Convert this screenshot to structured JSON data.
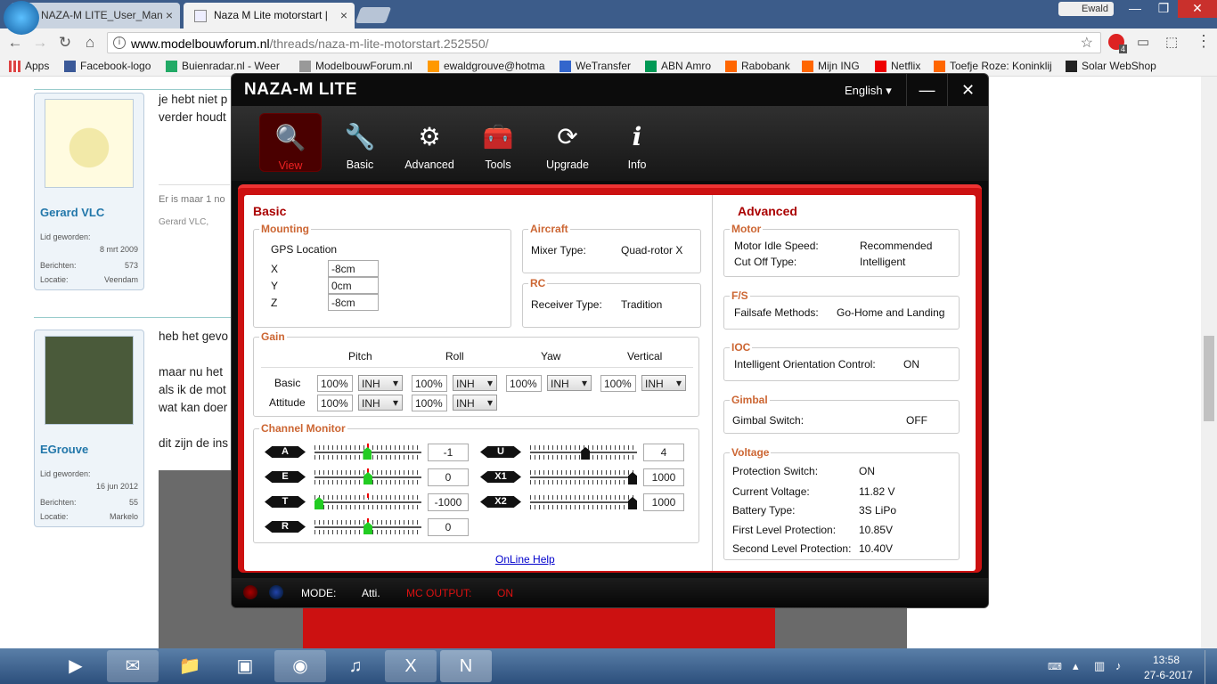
{
  "browser": {
    "tabs": [
      {
        "label": "NAZA-M LITE_User_Man"
      },
      {
        "label": "Naza M Lite motorstart |"
      }
    ],
    "profile": "Ewald",
    "url_domain": "www.modelbouwforum.nl",
    "url_path": "/threads/naza-m-lite-motorstart.252550/",
    "ext_badge": "4",
    "bookmarks": [
      {
        "label": "Apps",
        "color": "#d44"
      },
      {
        "label": "Facebook-logo",
        "color": "#3b5998"
      },
      {
        "label": "Buienradar.nl - Weer",
        "color": "#2a6"
      },
      {
        "label": "ModelbouwForum.nl",
        "color": "#999"
      },
      {
        "label": "ewaldgrouve@hotma",
        "color": "#f90"
      },
      {
        "label": "WeTransfer",
        "color": "#36c"
      },
      {
        "label": "ABN Amro",
        "color": "#095"
      },
      {
        "label": "Rabobank",
        "color": "#f60"
      },
      {
        "label": "Mijn ING",
        "color": "#f60"
      },
      {
        "label": "Netflix",
        "color": "#e00"
      },
      {
        "label": "Toefje Roze: Koninklij",
        "color": "#f60"
      },
      {
        "label": "Solar WebShop",
        "color": "#222"
      }
    ]
  },
  "forum": {
    "posts": [
      {
        "user": "Gerard VLC",
        "joined_label": "Lid geworden:",
        "joined": "8 mrt 2009",
        "posts_label": "Berichten:",
        "posts": "573",
        "loc_label": "Locatie:",
        "loc": "Veendam",
        "lines": [
          "je hebt niet p",
          "verder houdt"
        ],
        "footer1": "Er is maar 1 no",
        "footer2": "Gerard VLC,"
      },
      {
        "user": "EGrouve",
        "joined_label": "Lid geworden:",
        "joined": "16 jun 2012",
        "posts_label": "Berichten:",
        "posts": "55",
        "loc_label": "Locatie:",
        "loc": "Markelo",
        "lines": [
          "heb het gevo",
          "maar nu het",
          "als ik de mot",
          "wat kan doer",
          "dit zijn de ins"
        ]
      }
    ]
  },
  "naza": {
    "title": "NAZA-M LITE",
    "language": "English",
    "min_icon": "—",
    "close_icon": "✕",
    "menu": [
      {
        "label": "View",
        "icon": "🔍"
      },
      {
        "label": "Basic",
        "icon": "🔧"
      },
      {
        "label": "Advanced",
        "icon": "⚙"
      },
      {
        "label": "Tools",
        "icon": "🧰"
      },
      {
        "label": "Upgrade",
        "icon": "⟳"
      },
      {
        "label": "Info",
        "icon": "i"
      }
    ],
    "basic": {
      "heading": "Basic",
      "mounting": {
        "legend": "Mounting",
        "gps": "GPS Location",
        "x_label": "X",
        "x": "-8cm",
        "y_label": "Y",
        "y": "0cm",
        "z_label": "Z",
        "z": "-8cm"
      },
      "aircraft": {
        "legend": "Aircraft",
        "label": "Mixer Type:",
        "value": "Quad-rotor X"
      },
      "rc": {
        "legend": "RC",
        "label": "Receiver Type:",
        "value": "Tradition"
      },
      "gain": {
        "legend": "Gain",
        "cols": [
          "Pitch",
          "Roll",
          "Yaw",
          "Vertical"
        ],
        "basic_label": "Basic",
        "attitude_label": "Attitude",
        "basic": [
          {
            "v": "100%",
            "s": "INH"
          },
          {
            "v": "100%",
            "s": "INH"
          },
          {
            "v": "100%",
            "s": "INH"
          },
          {
            "v": "100%",
            "s": "INH"
          }
        ],
        "attitude": [
          {
            "v": "100%",
            "s": "INH"
          },
          {
            "v": "100%",
            "s": "INH"
          }
        ]
      },
      "channels": {
        "legend": "Channel Monitor",
        "left": [
          {
            "name": "A",
            "value": "-1",
            "pos": -0.01
          },
          {
            "name": "E",
            "value": "0",
            "pos": 0
          },
          {
            "name": "T",
            "value": "-1000",
            "pos": -1
          },
          {
            "name": "R",
            "value": "0",
            "pos": 0
          }
        ],
        "right": [
          {
            "name": "U",
            "value": "4",
            "pos": 0.04
          },
          {
            "name": "X1",
            "value": "1000",
            "pos": 1
          },
          {
            "name": "X2",
            "value": "1000",
            "pos": 1
          }
        ]
      },
      "help": "OnLine Help"
    },
    "advanced": {
      "heading": "Advanced",
      "motor": {
        "legend": "Motor",
        "idle_label": "Motor Idle Speed:",
        "idle": "Recommended",
        "cut_label": "Cut Off Type:",
        "cut": "Intelligent"
      },
      "fs": {
        "legend": "F/S",
        "label": "Failsafe Methods:",
        "value": "Go-Home and Landing"
      },
      "ioc": {
        "legend": "IOC",
        "label": "Intelligent Orientation Control:",
        "value": "ON"
      },
      "gimbal": {
        "legend": "Gimbal",
        "label": "Gimbal Switch:",
        "value": "OFF"
      },
      "voltage": {
        "legend": "Voltage",
        "rows": [
          {
            "label": "Protection Switch:",
            "value": "ON"
          },
          {
            "label": "Current Voltage:",
            "value": "11.82 V"
          },
          {
            "label": "Battery Type:",
            "value": "3S LiPo"
          },
          {
            "label": "First Level Protection:",
            "value": "10.85V"
          },
          {
            "label": "Second Level Protection:",
            "value": "10.40V"
          }
        ]
      }
    },
    "status": {
      "mode_label": "MODE:",
      "mode": "Atti.",
      "mc_label": "MC OUTPUT:",
      "mc": "ON"
    }
  },
  "taskbar": {
    "time": "13:58",
    "date": "27-6-2017"
  },
  "colors": {
    "accent": "#c11",
    "legend": "#c63",
    "heading": "#a00",
    "knob_green": "#2c2",
    "knob_black": "#111"
  }
}
